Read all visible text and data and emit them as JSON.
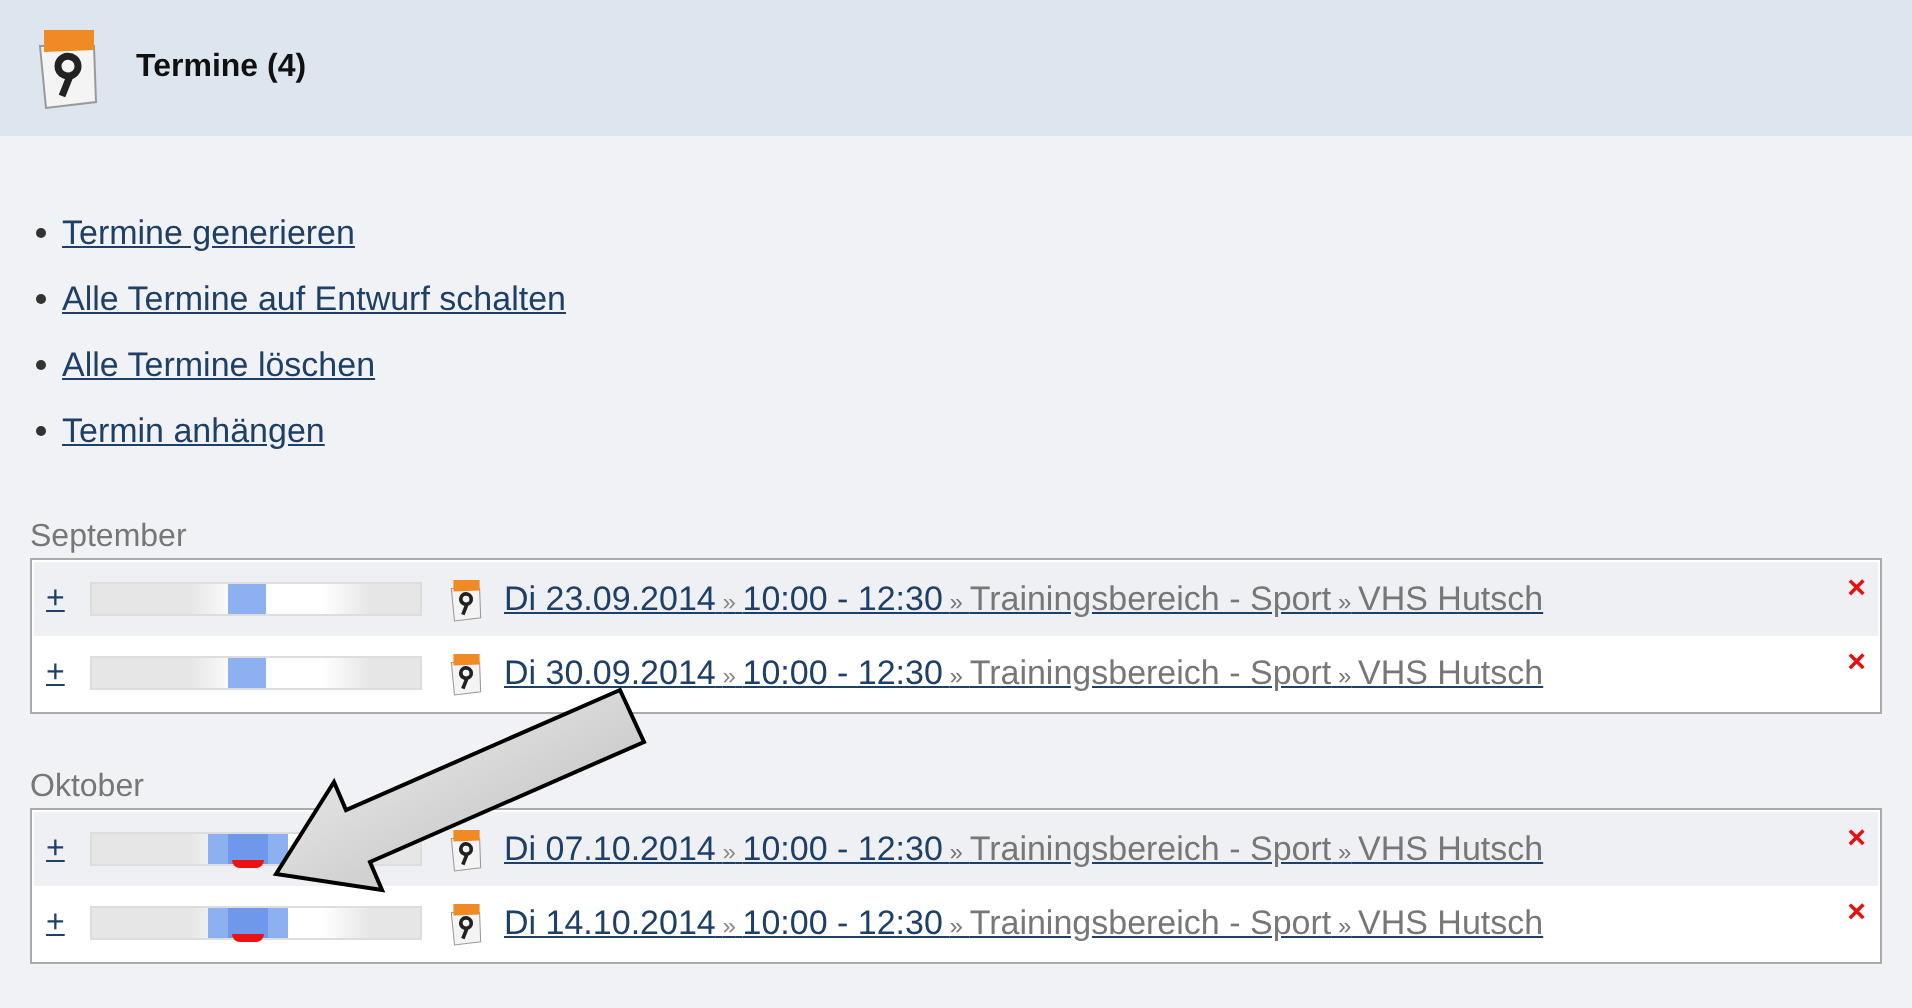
{
  "header": {
    "title": "Termine (4)"
  },
  "actions": [
    "Termine generieren",
    "Alle Termine auf Entwurf schalten",
    "Alle Termine löschen",
    "Termin anhängen"
  ],
  "months": [
    {
      "name": "September",
      "rows": [
        {
          "expand": "+",
          "date": "Di 23.09.2014",
          "time": "10:00 - 12:30",
          "category": "Trainingsbereich - Sport",
          "location": "VHS Hutsch",
          "separator": "»",
          "delete": "×",
          "conflict": false
        },
        {
          "expand": "+",
          "date": "Di 30.09.2014",
          "time": "10:00 - 12:30",
          "category": "Trainingsbereich - Sport",
          "location": "VHS Hutsch",
          "separator": "»",
          "delete": "×",
          "conflict": false
        }
      ]
    },
    {
      "name": "Oktober",
      "rows": [
        {
          "expand": "+",
          "date": "Di 07.10.2014",
          "time": "10:00 - 12:30",
          "category": "Trainingsbereich - Sport",
          "location": "VHS Hutsch",
          "separator": "»",
          "delete": "×",
          "conflict": true
        },
        {
          "expand": "+",
          "date": "Di 14.10.2014",
          "time": "10:00 - 12:30",
          "category": "Trainingsbereich - Sport",
          "location": "VHS Hutsch",
          "separator": "»",
          "delete": "×",
          "conflict": true
        }
      ]
    }
  ]
}
